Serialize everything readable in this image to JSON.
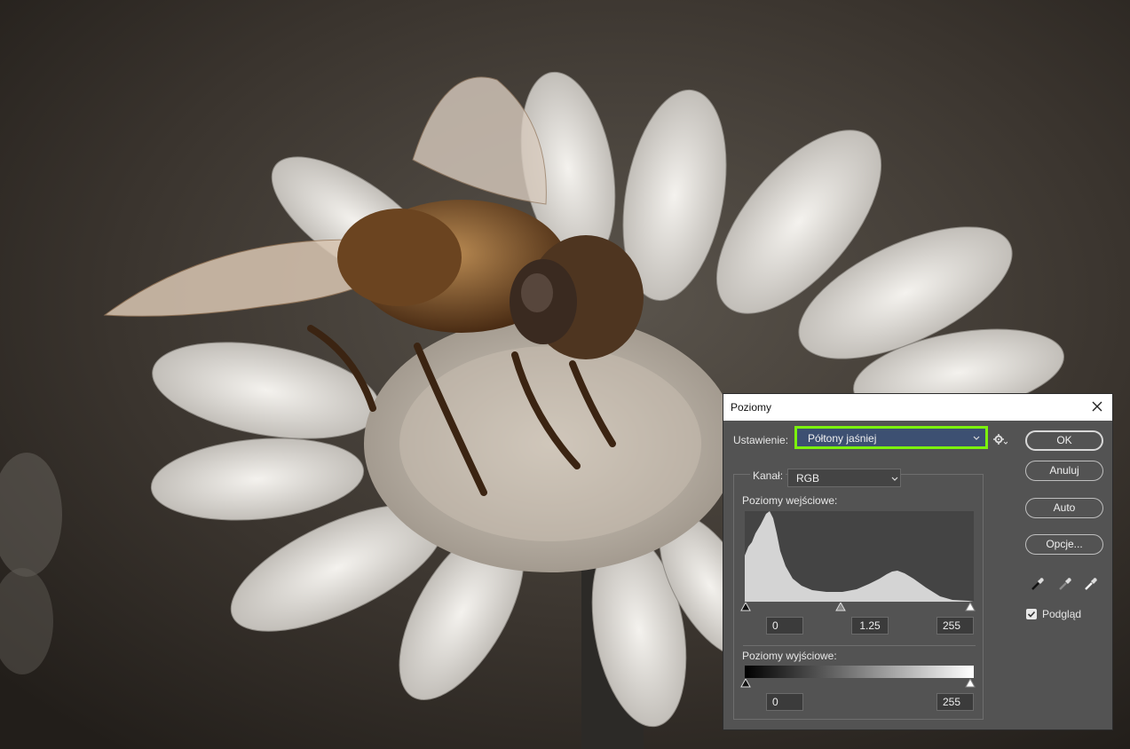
{
  "dialog": {
    "title": "Poziomy",
    "preset_label": "Ustawienie:",
    "preset_value": "Półtony jaśniej",
    "channel_label": "Kanał:",
    "channel_value": "RGB",
    "input_levels_label": "Poziomy wejściowe:",
    "input_black": "0",
    "input_gamma": "1.25",
    "input_white": "255",
    "output_levels_label": "Poziomy wyjściowe:",
    "output_black": "0",
    "output_white": "255",
    "buttons": {
      "ok": "OK",
      "cancel": "Anuluj",
      "auto": "Auto",
      "options": "Opcje..."
    },
    "preview_label": "Podgląd",
    "preview_checked": true
  },
  "colors": {
    "preset_highlight": "#7cf10d",
    "dialog_bg": "#535353",
    "histogram_fill": "#d4d4d4"
  },
  "icons": [
    "close-icon",
    "gear-icon",
    "chevron-down-icon",
    "eyedropper-black-icon",
    "eyedropper-gray-icon",
    "eyedropper-white-icon",
    "checkmark-icon"
  ]
}
